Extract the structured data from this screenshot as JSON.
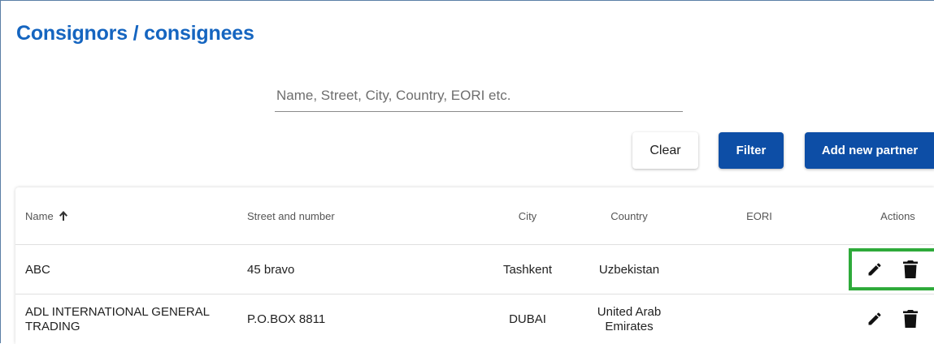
{
  "page": {
    "title": "Consignors / consignees"
  },
  "search": {
    "placeholder": "Name, Street, City, Country, EORI etc.",
    "value": ""
  },
  "toolbar": {
    "clear_label": "Clear",
    "filter_label": "Filter",
    "add_label": "Add new partner"
  },
  "table": {
    "columns": {
      "name": "Name",
      "street": "Street and number",
      "city": "City",
      "country": "Country",
      "eori": "EORI",
      "actions": "Actions"
    },
    "sort": {
      "column": "name",
      "direction": "ascending",
      "icon": "arrow-up-icon"
    },
    "rows": [
      {
        "name": "ABC",
        "street": "45 bravo",
        "city": "Tashkent",
        "country": "Uzbekistan",
        "eori": ""
      },
      {
        "name_line1": "ADL INTERNATIONAL GENERAL",
        "name_line2": "TRADING",
        "street": "P.O.BOX 8811",
        "city": "DUBAI",
        "country_line1": "United Arab",
        "country_line2": "Emirates",
        "eori": ""
      }
    ],
    "row_actions": [
      "edit-icon",
      "delete-icon"
    ]
  },
  "colors": {
    "title": "#1565c0",
    "primary_button": "#0d4ea6",
    "highlight_box": "#2eaa3a"
  }
}
